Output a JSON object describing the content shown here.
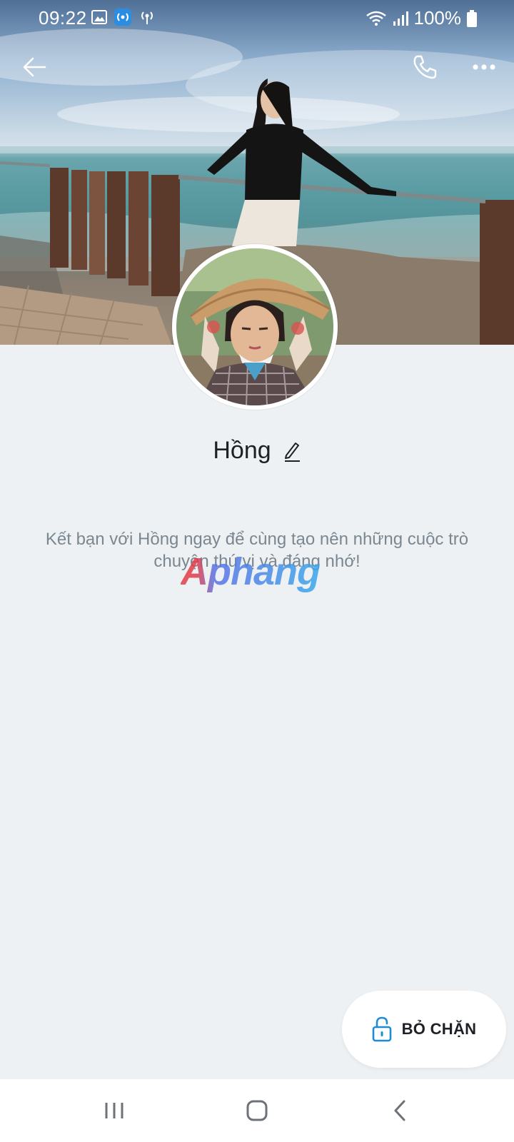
{
  "status_bar": {
    "time": "09:22",
    "battery_percent": "100%",
    "icons": [
      "gallery-icon",
      "hotspot-icon",
      "broadcast-icon",
      "wifi-icon",
      "signal-icon",
      "battery-icon"
    ]
  },
  "top_bar": {
    "back_icon": "back-arrow-icon",
    "call_icon": "phone-icon",
    "more_icon": "more-options-icon"
  },
  "profile": {
    "name": "Hồng",
    "edit_icon": "pencil-icon",
    "info_text": "Kết bạn với Hồng ngay để cùng tạo nên những cuộc trò chuyện thú vị và đáng nhớ!"
  },
  "watermark": "Aphang",
  "actions": {
    "unblock_label": "BỎ CHẶN",
    "unblock_icon": "unlock-icon"
  },
  "nav_bar": {
    "recents_icon": "recents-icon",
    "home_icon": "home-icon",
    "back_icon": "back-chevron-icon"
  },
  "colors": {
    "background": "#eef1f3",
    "accent": "#1e8bd6",
    "text_primary": "#1d2125",
    "text_secondary": "#7b8790"
  }
}
